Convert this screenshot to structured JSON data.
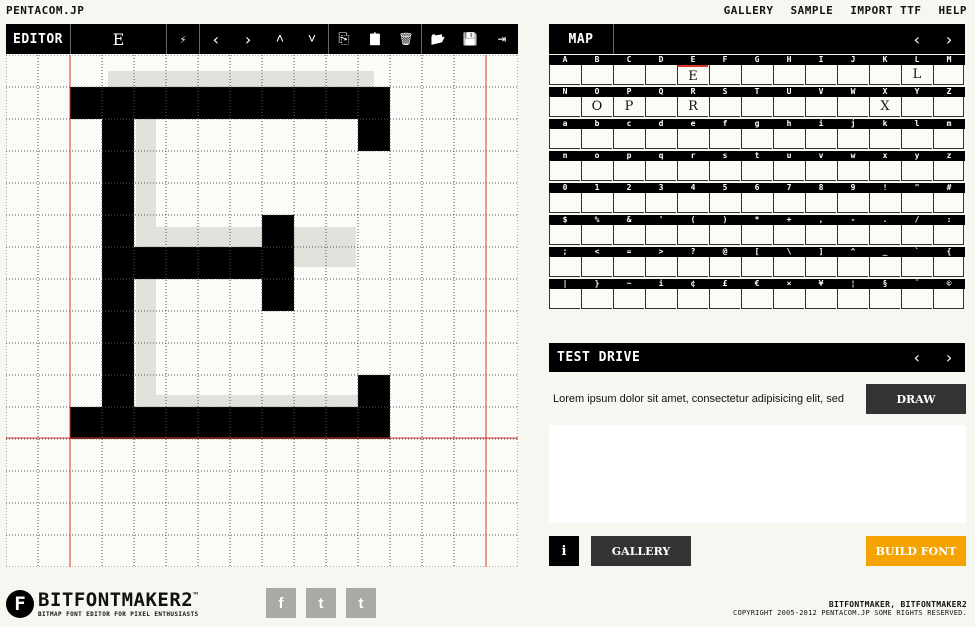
{
  "site": {
    "name": "PENTACOM.JP"
  },
  "nav": [
    "GALLERY",
    "SAMPLE",
    "IMPORT TTF",
    "HELP"
  ],
  "editor": {
    "label": "EDITOR",
    "current_char": "E",
    "tools": [
      "magic-wand-icon",
      "arrow-left-icon",
      "arrow-right-icon",
      "arrow-up-icon",
      "arrow-down-icon",
      "copy-icon",
      "paste-icon",
      "trash-icon",
      "open-folder-icon",
      "save-icon",
      "export-icon"
    ],
    "tool_glyphs": [
      "⚡",
      "‹",
      "›",
      "˄",
      "˅",
      "⎘",
      "📋",
      "🗑",
      "📂",
      "💾",
      "⇥"
    ],
    "grid": {
      "cols": 16,
      "rows": 16
    },
    "filled_cells": [
      [
        2,
        1
      ],
      [
        3,
        1
      ],
      [
        4,
        1
      ],
      [
        5,
        1
      ],
      [
        6,
        1
      ],
      [
        7,
        1
      ],
      [
        8,
        1
      ],
      [
        9,
        1
      ],
      [
        10,
        1
      ],
      [
        11,
        1
      ],
      [
        3,
        2
      ],
      [
        11,
        2
      ],
      [
        3,
        3
      ],
      [
        3,
        4
      ],
      [
        3,
        5
      ],
      [
        8,
        5
      ],
      [
        3,
        6
      ],
      [
        4,
        6
      ],
      [
        5,
        6
      ],
      [
        6,
        6
      ],
      [
        7,
        6
      ],
      [
        8,
        6
      ],
      [
        3,
        7
      ],
      [
        8,
        7
      ],
      [
        3,
        8
      ],
      [
        3,
        9
      ],
      [
        3,
        10
      ],
      [
        11,
        10
      ],
      [
        2,
        11
      ],
      [
        3,
        11
      ],
      [
        4,
        11
      ],
      [
        5,
        11
      ],
      [
        6,
        11
      ],
      [
        7,
        11
      ],
      [
        8,
        11
      ],
      [
        9,
        11
      ],
      [
        10,
        11
      ],
      [
        11,
        11
      ]
    ]
  },
  "map": {
    "label": "MAP",
    "prev": "‹",
    "next": "›",
    "rows": [
      {
        "chars": [
          "A",
          "B",
          "C",
          "D",
          "E",
          "F",
          "G",
          "H",
          "I",
          "J",
          "K",
          "L",
          "M"
        ],
        "drawn": [
          "",
          "",
          "",
          "",
          "E",
          "",
          "",
          "",
          "",
          "",
          "",
          "L",
          ""
        ]
      },
      {
        "chars": [
          "N",
          "O",
          "P",
          "Q",
          "R",
          "S",
          "T",
          "U",
          "V",
          "W",
          "X",
          "Y",
          "Z"
        ],
        "drawn": [
          "",
          "O",
          "P",
          "",
          "R",
          "",
          "",
          "",
          "",
          "",
          "X",
          "",
          ""
        ]
      },
      {
        "chars": [
          "a",
          "b",
          "c",
          "d",
          "e",
          "f",
          "g",
          "h",
          "i",
          "j",
          "k",
          "l",
          "m"
        ],
        "drawn": [
          "",
          "",
          "",
          "",
          "",
          "",
          "",
          "",
          "",
          "",
          "",
          "",
          ""
        ]
      },
      {
        "chars": [
          "n",
          "o",
          "p",
          "q",
          "r",
          "s",
          "t",
          "u",
          "v",
          "w",
          "x",
          "y",
          "z"
        ],
        "drawn": [
          "",
          "",
          "",
          "",
          "",
          "",
          "",
          "",
          "",
          "",
          "",
          "",
          ""
        ]
      },
      {
        "chars": [
          "0",
          "1",
          "2",
          "3",
          "4",
          "5",
          "6",
          "7",
          "8",
          "9",
          "!",
          "\"",
          "#"
        ],
        "drawn": [
          "",
          "",
          "",
          "",
          "",
          "",
          "",
          "",
          "",
          "",
          "",
          "",
          ""
        ]
      },
      {
        "chars": [
          "$",
          "%",
          "&",
          "'",
          "(",
          ")",
          "*",
          "+",
          ",",
          "-",
          ".",
          "/",
          ":"
        ],
        "drawn": [
          "",
          "",
          "",
          "",
          "",
          "",
          "",
          "",
          "",
          "",
          "",
          "",
          ""
        ]
      },
      {
        "chars": [
          ";",
          "<",
          "=",
          ">",
          "?",
          "@",
          "[",
          "\\",
          "]",
          "^",
          "_",
          "`",
          "{"
        ],
        "drawn": [
          "",
          "",
          "",
          "",
          "",
          "",
          "",
          "",
          "",
          "",
          "",
          "",
          ""
        ]
      },
      {
        "chars": [
          "|",
          "}",
          "~",
          "i",
          "¢",
          "£",
          "€",
          "×",
          "¥",
          "¦",
          "§",
          "¨",
          "©"
        ],
        "drawn": [
          "",
          "",
          "",
          "",
          "",
          "",
          "",
          "",
          "",
          "",
          "",
          "",
          ""
        ]
      }
    ]
  },
  "test_drive": {
    "label": "TEST DRIVE",
    "prev": "‹",
    "next": "›",
    "sample_text": "Lorem ipsum dolor sit amet, consectetur adipisicing elit, sed",
    "draw_label": "DRAW"
  },
  "buttons": {
    "info": "i",
    "gallery": "GALLERY",
    "build": "BUILD FONT"
  },
  "footer": {
    "logo_letter": "F",
    "logo": "BITFONTMAKER2",
    "tm": "™",
    "tagline": "BITMAP FONT EDITOR FOR PIXEL ENTHUSIASTS",
    "social": [
      "f",
      "t",
      "t"
    ],
    "copyright_title": "BITFONTMAKER, BITFONTMAKER2",
    "copyright": "COPYRIGHT 2005-2012 PENTACOM.JP SOME RIGHTS RESERVED."
  },
  "colors": {
    "accent": "#f5a300",
    "bar": "#000000",
    "grid_line": "#d8352f",
    "button_dark": "#333333"
  }
}
